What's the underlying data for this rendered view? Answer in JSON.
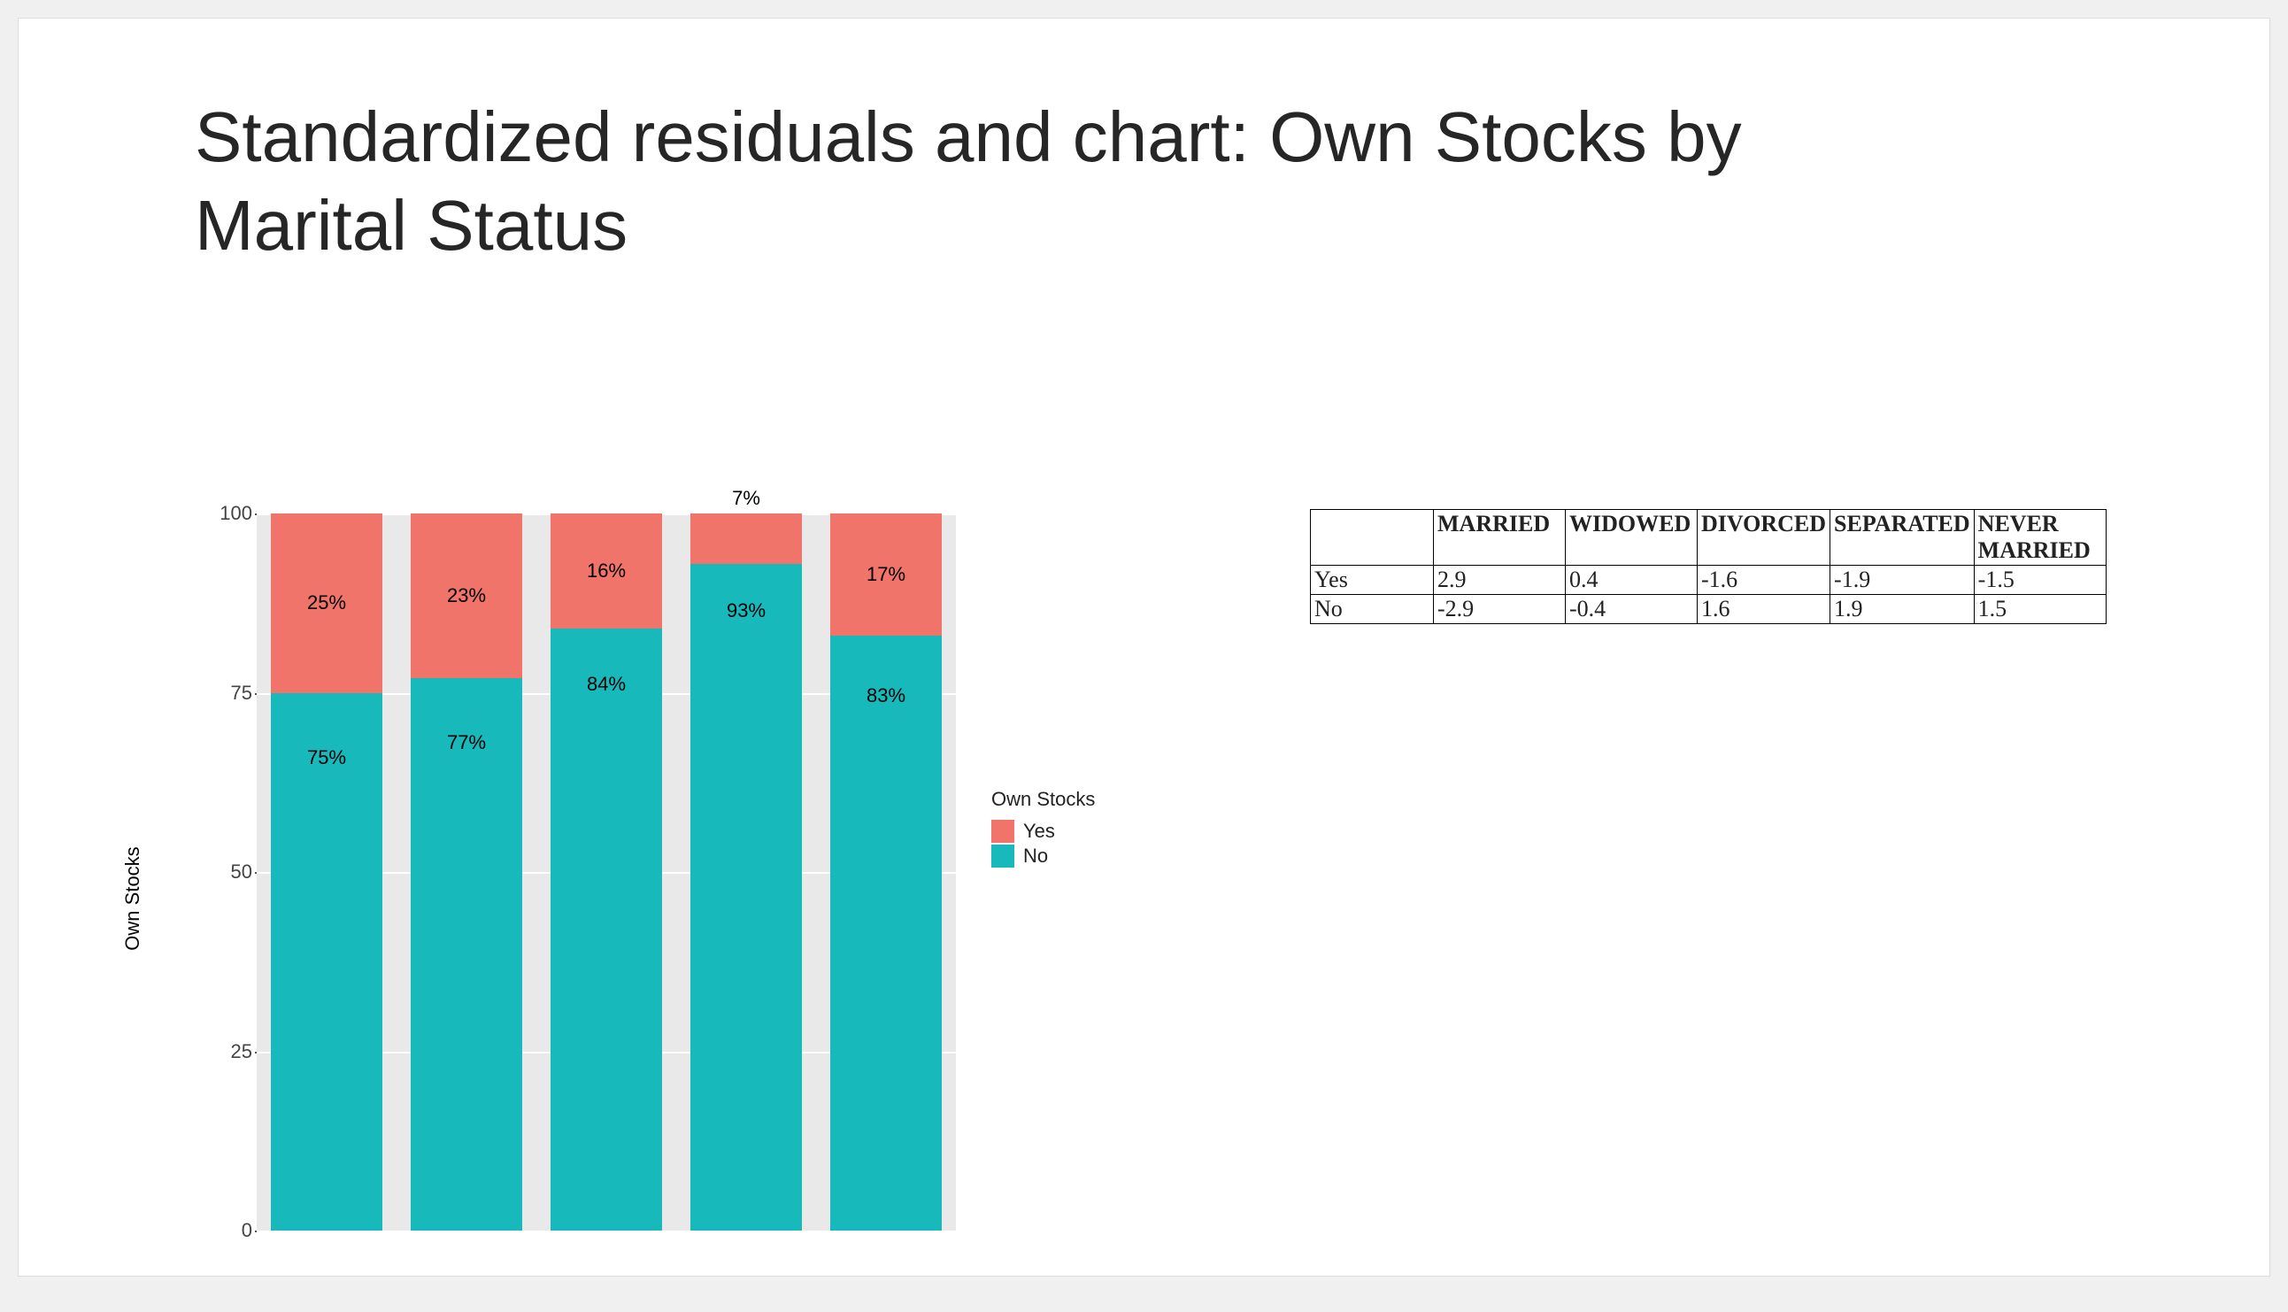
{
  "title": "Standardized residuals and chart: Own Stocks by Marital Status",
  "legend": {
    "title": "Own Stocks",
    "yes": "Yes",
    "no": "No"
  },
  "ylabel": "Own Stocks",
  "yticks": [
    "0",
    "25",
    "50",
    "75",
    "100"
  ],
  "table": {
    "headers": [
      "",
      "MARRIED",
      "WIDOWED",
      "DIVORCED",
      "SEPARATED",
      "NEVER MARRIED"
    ],
    "rows": [
      {
        "label": "Yes",
        "values": [
          "2.9",
          "0.4",
          "-1.6",
          "-1.9",
          "-1.5"
        ]
      },
      {
        "label": "No",
        "values": [
          "-2.9",
          "-0.4",
          "1.6",
          "1.9",
          "1.5"
        ]
      }
    ]
  },
  "chart_data": {
    "type": "bar",
    "stacked": true,
    "ylabel": "Own Stocks",
    "ylim": [
      0,
      100
    ],
    "categories": [
      "MARRIED",
      "WIDOWED",
      "DIVORCED",
      "SEPARATED",
      "NEVER MARRIED"
    ],
    "series": [
      {
        "name": "No",
        "values": [
          75,
          77,
          84,
          93,
          83
        ]
      },
      {
        "name": "Yes",
        "values": [
          25,
          23,
          16,
          7,
          17
        ]
      }
    ],
    "data_labels": {
      "No": [
        "75%",
        "77%",
        "84%",
        "93%",
        "83%"
      ],
      "Yes": [
        "25%",
        "23%",
        "16%",
        "7%",
        "17%"
      ]
    },
    "legend_position": "right",
    "grid": true
  }
}
